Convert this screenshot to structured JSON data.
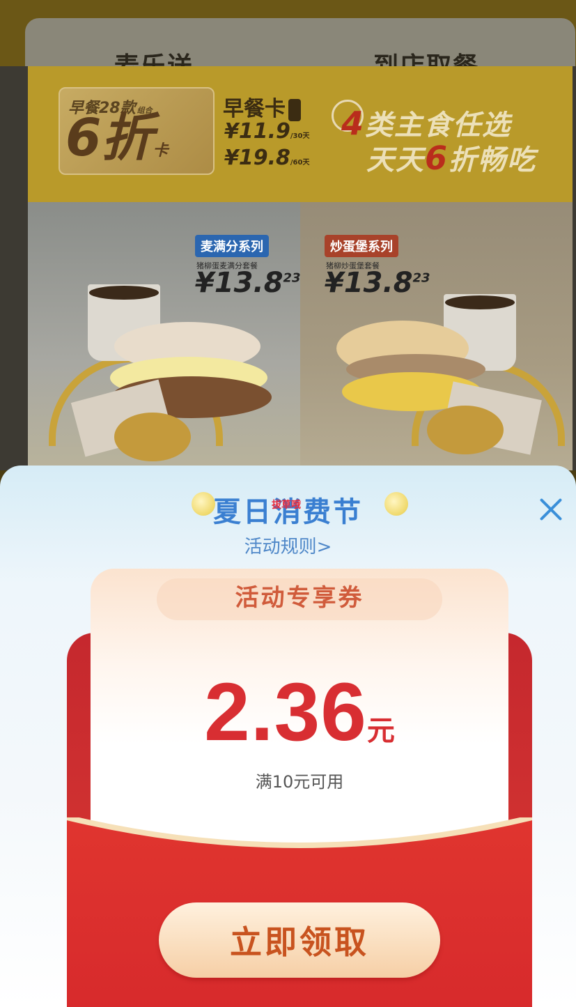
{
  "background": {
    "tabs": [
      {
        "label": "麦乐送"
      },
      {
        "label": "到店取餐"
      }
    ],
    "banner": {
      "badge_top": "早餐28款",
      "badge_top_small": "组合",
      "badge_big": "6折",
      "badge_big_small": "卡",
      "card_name": "早餐卡",
      "prices": [
        {
          "price": "¥11.9",
          "period": "/30天"
        },
        {
          "price": "¥19.8",
          "period": "/60天"
        }
      ],
      "slogan_1_num": "4",
      "slogan_1_text": "类主食任选",
      "slogan_2_pre": "天天",
      "slogan_2_num": "6",
      "slogan_2_post": "折畅吃",
      "products": [
        {
          "series": "麦满分系列",
          "name": "猪柳蛋麦满分套餐",
          "price": "¥13.8",
          "original": "23",
          "color": "#2b66b0"
        },
        {
          "series": "炒蛋堡系列",
          "name": "猪柳炒蛋堡套餐",
          "price": "¥13.8",
          "original": "23",
          "color": "#a8422a"
        }
      ]
    }
  },
  "popup": {
    "title": "夏日消费节",
    "watermark": "拔草哦",
    "rules_link": "活动规则>",
    "coupon": {
      "title": "活动专享券",
      "amount": "2.36",
      "unit": "元",
      "condition": "满10元可用"
    },
    "claim_button": "立即领取",
    "colors": {
      "accent_blue": "#3a7fd1",
      "coupon_red": "#d82e32",
      "button_text": "#c8531f"
    }
  }
}
